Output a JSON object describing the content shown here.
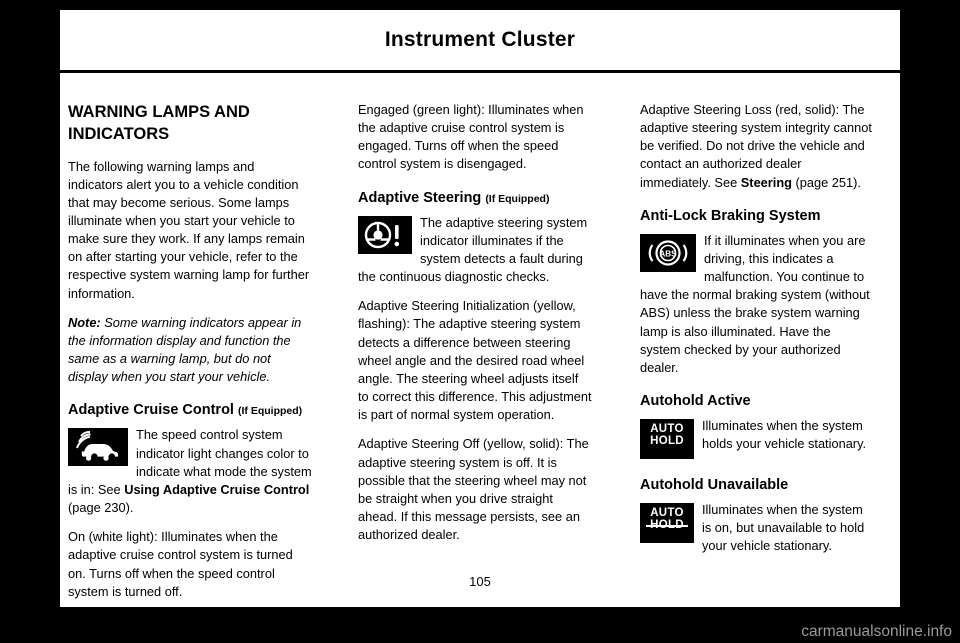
{
  "header": {
    "title": "Instrument Cluster"
  },
  "page_number": "105",
  "watermark": "carmanualsonline.info",
  "column1": {
    "section_title": "WARNING LAMPS AND INDICATORS",
    "intro": "The following warning lamps and indicators alert you to a vehicle condition that may become serious. Some lamps illuminate when you start your vehicle to make sure they work. If any lamps remain on after starting your vehicle, refer to the respective system warning lamp for further information.",
    "note_label": "Note:",
    "note_text": " Some warning indicators appear in the information display and function the same as a warning lamp, but do not display when you start your vehicle.",
    "acc_heading": "Adaptive Cruise Control",
    "acc_heading_eq": "(If Equipped)",
    "acc_icon_name": "adaptive-cruise-control-icon",
    "acc_fig_text_1": "The speed control system indicator light changes color to indicate what mode the system is in:  See ",
    "acc_fig_link": "Using Adaptive Cruise Control",
    "acc_fig_text_2": " (page 230).",
    "acc_white": "On (white light): Illuminates when the adaptive cruise control system is turned on. Turns off when the speed control system is turned off."
  },
  "column2": {
    "acc_green": "Engaged (green light): Illuminates when the adaptive cruise control system is engaged. Turns off when the speed control system is disengaged.",
    "steer_heading": "Adaptive Steering",
    "steer_heading_eq": "(If Equipped)",
    "steer_icon_name": "adaptive-steering-warning-icon",
    "steer_fig_text": "The adaptive steering system indicator illuminates if the system detects a fault during the continuous diagnostic checks.",
    "steer_init": "Adaptive Steering Initialization (yellow, flashing): The adaptive steering system detects a difference between steering wheel angle and the desired road wheel angle. The steering wheel adjusts itself to correct this difference. This adjustment is part of normal system operation.",
    "steer_off": "Adaptive Steering Off (yellow, solid): The adaptive steering system is off. It is possible that the steering wheel may not be straight when you drive straight ahead. If this message persists, see an authorized dealer."
  },
  "column3": {
    "steer_loss_text_1": "Adaptive Steering Loss (red, solid): The adaptive steering system integrity cannot be verified. Do not drive the vehicle and contact an authorized dealer immediately. See ",
    "steer_loss_link": "Steering",
    "steer_loss_text_2": " (page 251).",
    "abs_heading": "Anti-Lock Braking System",
    "abs_icon_name": "abs-warning-icon",
    "abs_fig_text": "If it illuminates when you are driving, this indicates a malfunction. You continue to have the normal braking system (without ABS) unless the brake system warning lamp is also illuminated. Have the system checked by your authorized dealer.",
    "autohold_active_heading": "Autohold Active",
    "autohold_icon_line1": "AUTO",
    "autohold_icon_line2": "HOLD",
    "autohold_active_text": "Illuminates when the system holds your vehicle stationary.",
    "autohold_unavail_heading": "Autohold Unavailable",
    "autohold_unavail_text": "Illuminates when the system is on, but unavailable to hold your vehicle stationary."
  }
}
